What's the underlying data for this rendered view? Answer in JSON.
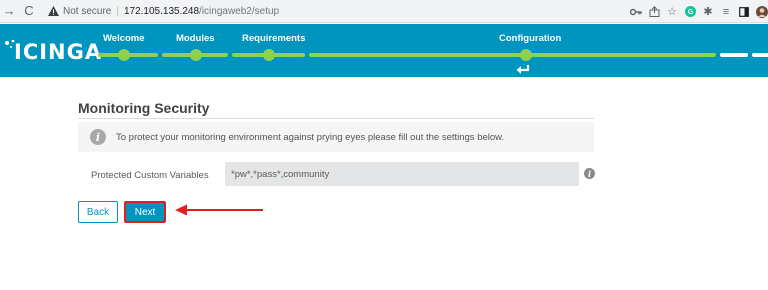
{
  "browser": {
    "security_label": "Not secure",
    "host": "172.105.135.248",
    "path": "/icingaweb2/setup",
    "icons": [
      "back-icon",
      "reload-icon",
      "key-icon",
      "share-icon",
      "star-icon",
      "grammarly-icon",
      "extensions-icon",
      "reading-list-icon",
      "sidepanel-icon",
      "profile-avatar"
    ]
  },
  "header": {
    "logo": "icinga",
    "steps": [
      {
        "label": "Welcome"
      },
      {
        "label": "Modules"
      },
      {
        "label": "Requirements"
      },
      {
        "label": "Configuration"
      }
    ],
    "accent_color": "#0095bf",
    "progress_color": "#8fd14f"
  },
  "main": {
    "title": "Monitoring Security",
    "info_text": "To protect your monitoring environment against prying eyes please fill out the settings below.",
    "field": {
      "label": "Protected Custom Variables",
      "value": "*pw*,*pass*,community"
    },
    "buttons": {
      "back": "Back",
      "next": "Next"
    },
    "annotation_color": "#e0201f"
  }
}
